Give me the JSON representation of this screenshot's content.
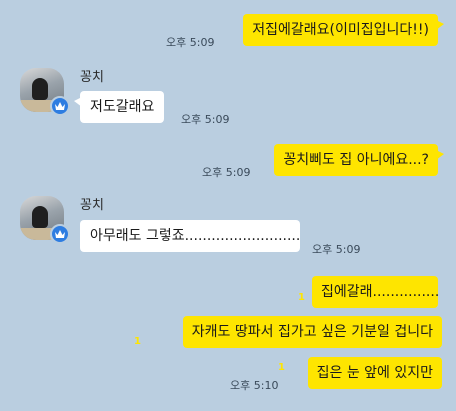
{
  "messages": [
    {
      "from": "me",
      "text": "저집에갈래요(이미집입니다!!)",
      "time": "오후 5:09"
    },
    {
      "from": "other",
      "sender": "꽁치",
      "text": "저도갈래요",
      "time": "오후 5:09"
    },
    {
      "from": "me",
      "text": "꽁치삐도 집 아니에요...?",
      "time": "오후 5:09"
    },
    {
      "from": "other",
      "sender": "꽁치",
      "text": "아무래도 그렇죠..............................",
      "time": "오후 5:09"
    },
    {
      "from": "me",
      "text": "집에갈래..................",
      "unread": "1"
    },
    {
      "from": "me",
      "text": "자캐도 땅파서 집가고 싶은 기분일 겁니다",
      "unread": "1"
    },
    {
      "from": "me",
      "text": "집은 눈 앞에 있지만",
      "unread": "1",
      "time": "오후 5:10"
    }
  ],
  "colors": {
    "background": "#bacee0",
    "my_bubble": "#fee500",
    "other_bubble": "#ffffff",
    "badge": "#2e7de1"
  },
  "icons": {
    "avatar_badge": "crown-icon"
  }
}
